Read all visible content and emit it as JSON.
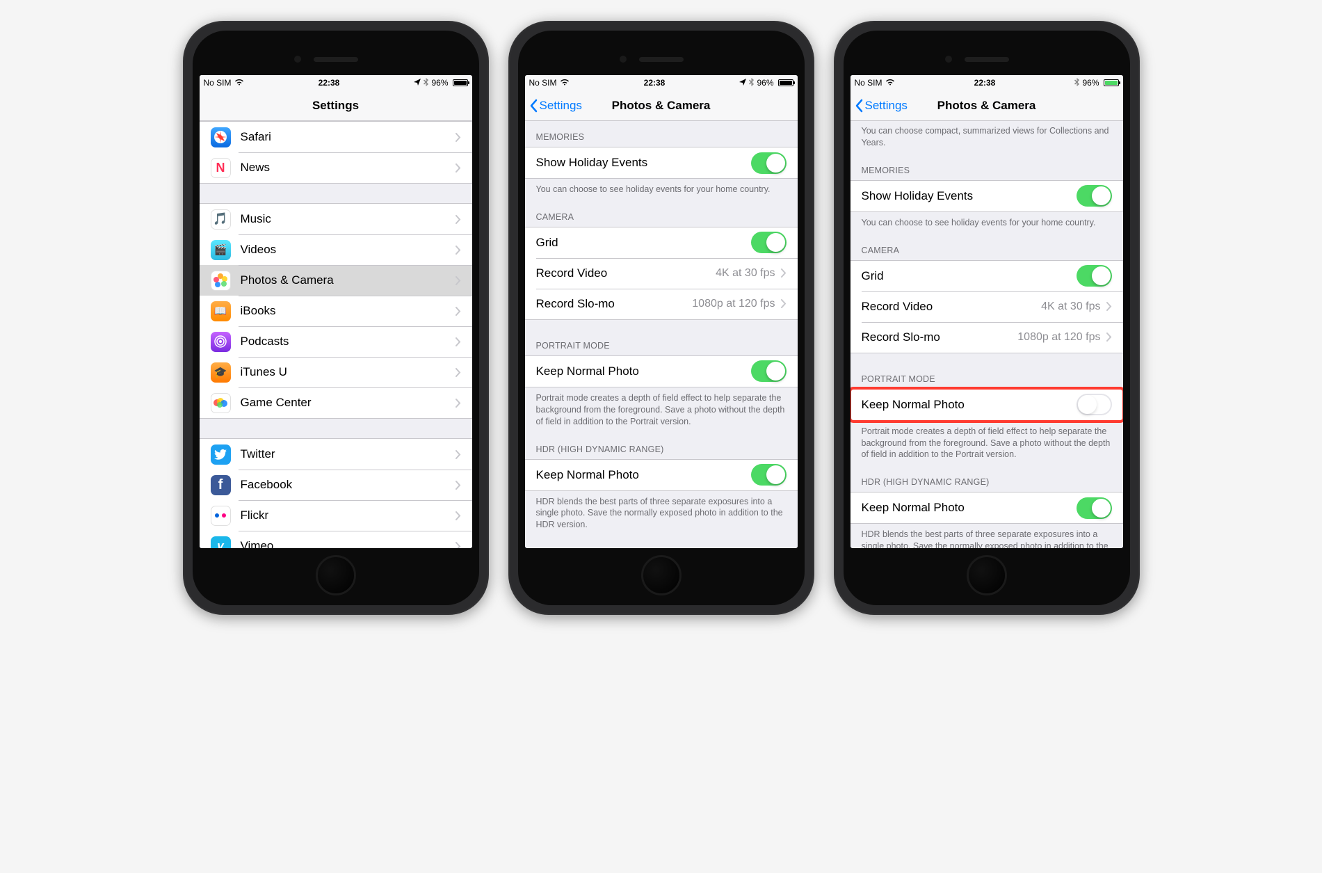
{
  "status": {
    "carrier": "No SIM",
    "time": "22:38",
    "battery_pct": "96%",
    "sb3_battery_pct": "96%"
  },
  "phone1": {
    "nav_title": "Settings",
    "groups": [
      [
        {
          "icon": "safari",
          "label": "Safari"
        },
        {
          "icon": "news",
          "label": "News"
        }
      ],
      [
        {
          "icon": "music",
          "label": "Music"
        },
        {
          "icon": "videos",
          "label": "Videos"
        },
        {
          "icon": "photos",
          "label": "Photos & Camera",
          "selected": true
        },
        {
          "icon": "ibooks",
          "label": "iBooks"
        },
        {
          "icon": "podcasts",
          "label": "Podcasts"
        },
        {
          "icon": "itunesu",
          "label": "iTunes U"
        },
        {
          "icon": "gamecenter",
          "label": "Game Center"
        }
      ],
      [
        {
          "icon": "twitter",
          "label": "Twitter"
        },
        {
          "icon": "facebook",
          "label": "Facebook"
        },
        {
          "icon": "flickr",
          "label": "Flickr"
        },
        {
          "icon": "vimeo",
          "label": "Vimeo"
        }
      ]
    ]
  },
  "phone2": {
    "nav_back": "Settings",
    "nav_title": "Photos & Camera",
    "memories_header": "MEMORIES",
    "holiday_label": "Show Holiday Events",
    "holiday_footer": "You can choose to see holiday events for your home country.",
    "camera_header": "CAMERA",
    "grid_label": "Grid",
    "record_video_label": "Record Video",
    "record_video_value": "4K at 30 fps",
    "record_slomo_label": "Record Slo-mo",
    "record_slomo_value": "1080p at 120 fps",
    "portrait_header": "PORTRAIT MODE",
    "keep_normal_label": "Keep Normal Photo",
    "portrait_footer": "Portrait mode creates a depth of field effect to help separate the background from the foreground. Save a photo without the depth of field in addition to the Portrait version.",
    "hdr_header": "HDR (HIGH DYNAMIC RANGE)",
    "hdr_keep_label": "Keep Normal Photo",
    "hdr_footer": "HDR blends the best parts of three separate exposures into a single photo. Save the normally exposed photo in addition to the HDR version."
  },
  "phone3": {
    "nav_back": "Settings",
    "nav_title": "Photos & Camera",
    "summary_footer": "You can choose compact, summarized views for Collections and Years.",
    "memories_header": "MEMORIES",
    "holiday_label": "Show Holiday Events",
    "holiday_footer": "You can choose to see holiday events for your home country.",
    "camera_header": "CAMERA",
    "grid_label": "Grid",
    "record_video_label": "Record Video",
    "record_video_value": "4K at 30 fps",
    "record_slomo_label": "Record Slo-mo",
    "record_slomo_value": "1080p at 120 fps",
    "portrait_header": "PORTRAIT MODE",
    "keep_normal_label": "Keep Normal Photo",
    "portrait_footer": "Portrait mode creates a depth of field effect to help separate the background from the foreground. Save a photo without the depth of field in addition to the Portrait version.",
    "hdr_header": "HDR (HIGH DYNAMIC RANGE)",
    "hdr_keep_label": "Keep Normal Photo",
    "hdr_footer": "HDR blends the best parts of three separate exposures into a single photo. Save the normally exposed photo in addition to the HDR version."
  }
}
